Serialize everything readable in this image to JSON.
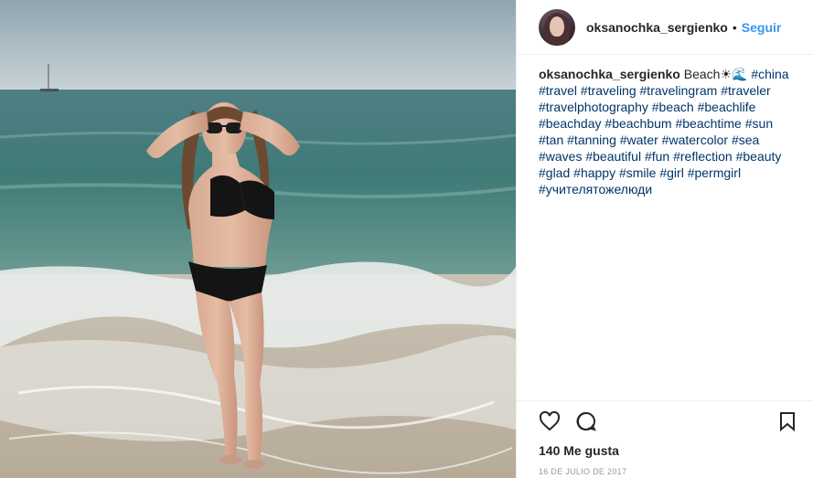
{
  "post": {
    "image_alt": "photo of woman in black bikini on beach",
    "header": {
      "username": "oksanochka_sergienko",
      "separator": "•",
      "follow_label": "Seguir"
    },
    "caption": {
      "username": "oksanochka_sergienko",
      "text": "Beach☀🌊",
      "hashtags": [
        "#china",
        "#travel",
        "#traveling",
        "#travelingram",
        "#traveler",
        "#travelphotography",
        "#beach",
        "#beachlife",
        "#beachday",
        "#beachbum",
        "#beachtime",
        "#sun",
        "#tan",
        "#tanning",
        "#water",
        "#watercolor",
        "#sea",
        "#waves",
        "#beautiful",
        "#fun",
        "#reflection",
        "#beauty",
        "#glad",
        "#happy",
        "#smile",
        "#girl",
        "#permgirl",
        "#учителятожелюди"
      ]
    },
    "actions": {
      "icons": [
        "heart-icon",
        "comment-icon",
        "bookmark-icon"
      ]
    },
    "likes_text": "140 Me gusta",
    "date_text": "16 DE JULIO DE 2017",
    "colors": {
      "link": "#3897f0",
      "hashtag": "#003569",
      "text": "#262626",
      "muted": "#999999",
      "border": "#efefef"
    }
  }
}
